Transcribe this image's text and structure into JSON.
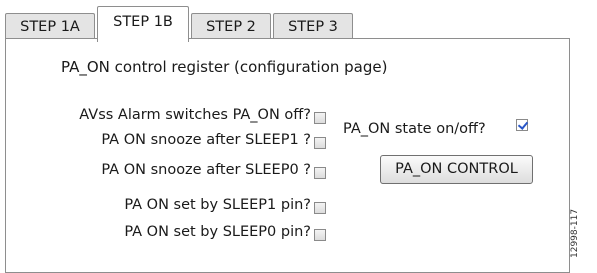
{
  "tabs": [
    {
      "label": "STEP 1A",
      "active": false
    },
    {
      "label": "STEP 1B",
      "active": true
    },
    {
      "label": "STEP 2",
      "active": false
    },
    {
      "label": "STEP 3",
      "active": false
    }
  ],
  "panel": {
    "title": "PA_ON control register (configuration page)",
    "options": [
      {
        "label": "AVss Alarm switches PA_ON off?",
        "checked": false
      },
      {
        "label": "PA ON snooze after SLEEP1 ?",
        "checked": false
      },
      {
        "label": "PA ON snooze after SLEEP0 ?",
        "checked": false
      },
      {
        "label": "PA ON set by SLEEP1 pin?",
        "checked": false
      },
      {
        "label": "PA ON set by SLEEP0 pin?",
        "checked": false
      }
    ],
    "state": {
      "label": "PA_ON state on/off?",
      "checked": true
    },
    "control_button": "PA_ON CONTROL"
  },
  "figure_id": "12998-117",
  "colors": {
    "check_mark": "#2a57c8",
    "tab_inactive": "#e4e4e4",
    "border": "#8e8e8e"
  }
}
